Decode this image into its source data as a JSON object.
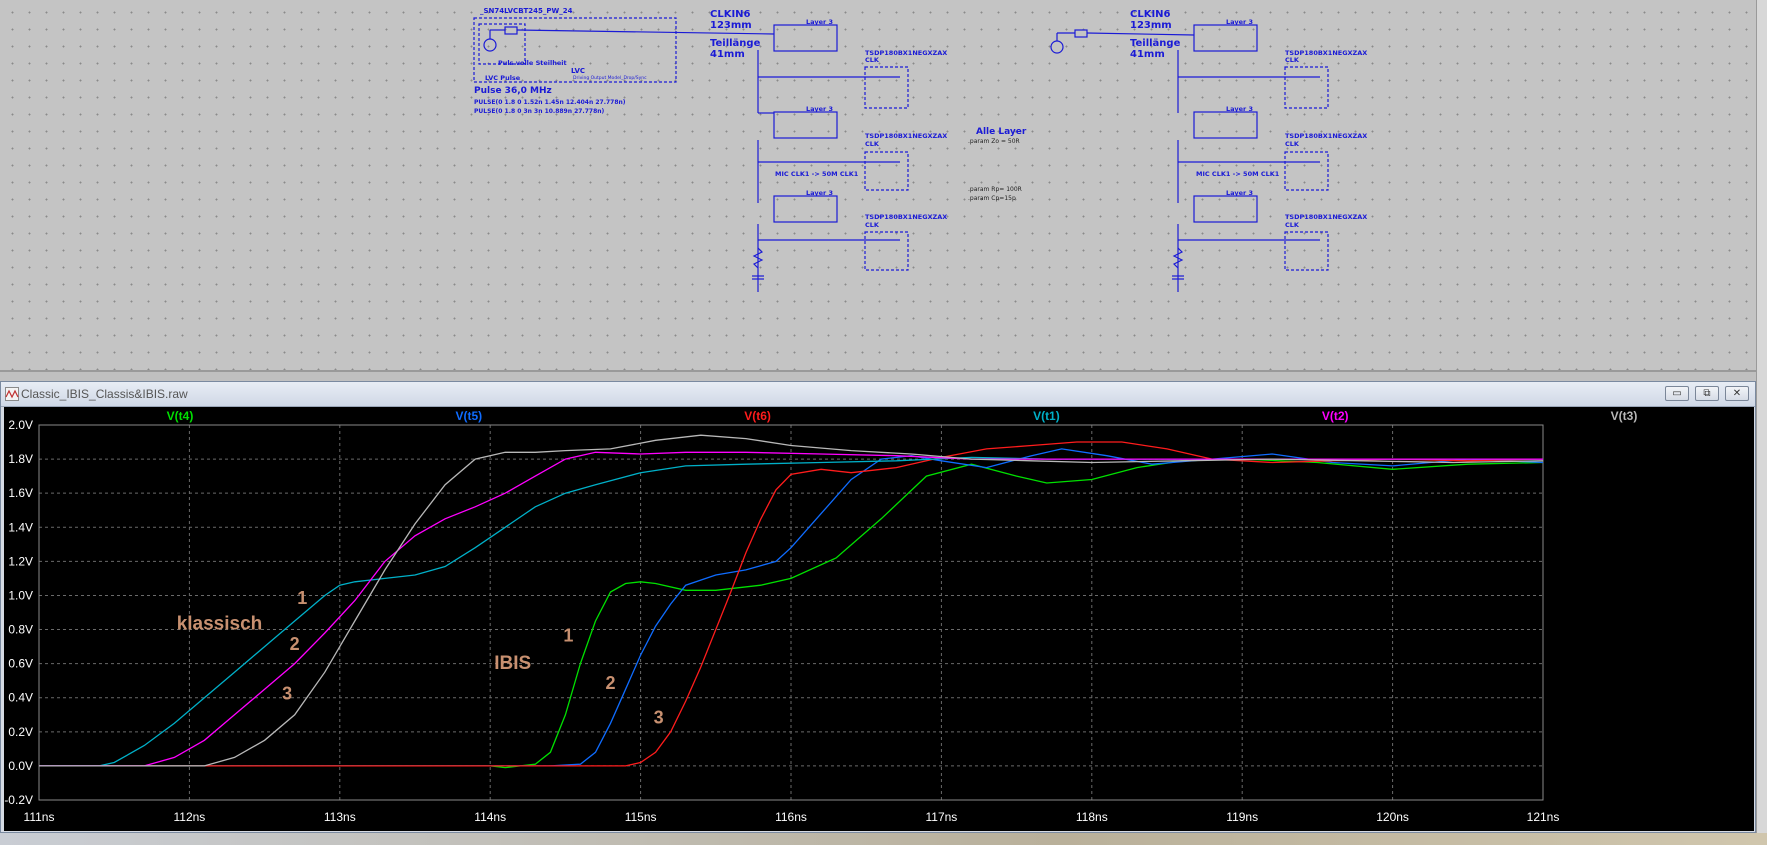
{
  "schematic": {
    "left_circuit": {
      "component_title": "_SN74LVCBT245_PW_24",
      "source_name": "Puls volle Steilheit",
      "block_label": "LVC",
      "block_sublabel": "Driving Output Model_Drop/Sync",
      "pulse_label": "LVC Pulse",
      "pulse_freq": "Pulse 36,0 MHz",
      "pulse_line_1": "PULSE(0 1.8 0 1.52n 1.45n 12.404n 27.778n)",
      "pulse_line_2": "PULSE(0 1.8 0 3n 3n 10.889n 27.778n)",
      "net_label": "CLKIN6",
      "length": "123mm",
      "segment_label": "Teillänge",
      "segment_length": "41mm",
      "layer_labels": [
        "Layer 3",
        "Layer 3",
        "Layer 3"
      ],
      "receiver_labels": [
        "TSDP180BX1NEGXZAX",
        "TSDP180BX1NEGXZAX",
        "TSDP180BX1NEGXZAX"
      ],
      "receiver_pin": "CLK",
      "mid_note": "MIC CLK1 -> 50M CLK1"
    },
    "right_circuit": {
      "net_label": "CLKIN6",
      "length": "123mm",
      "segment_label": "Teillänge",
      "segment_length": "41mm",
      "layer_labels": [
        "Layer 3",
        "Layer 3",
        "Layer 3"
      ],
      "receiver_labels": [
        "TSDP180BX1NEGXZAX",
        "TSDP180BX1NEGXZAX",
        "TSDP180BX1NEGXZAX"
      ],
      "receiver_pin": "CLK",
      "mid_note": "MIC CLK1 -> 50M CLK1"
    },
    "params": {
      "header": "Alle Layer",
      "zo": ".param Zo = 50R",
      "rp": ".param Rp= 100R",
      "cp": ".param Cp=15p"
    }
  },
  "window": {
    "title": "Classic_IBIS_Classis&IBIS.raw",
    "min_glyph": "▭",
    "max_glyph": "⧉",
    "close_glyph": "✕"
  },
  "chart_data": {
    "type": "line",
    "xlabel": "",
    "ylabel": "",
    "xlim": [
      111,
      121
    ],
    "ylim": [
      -0.2,
      2.0
    ],
    "grid": true,
    "x_ticks": [
      "111ns",
      "112ns",
      "113ns",
      "114ns",
      "115ns",
      "116ns",
      "117ns",
      "118ns",
      "119ns",
      "120ns",
      "121ns"
    ],
    "y_ticks": [
      "-0.2V",
      "0.0V",
      "0.2V",
      "0.4V",
      "0.6V",
      "0.8V",
      "1.0V",
      "1.2V",
      "1.4V",
      "1.6V",
      "1.8V",
      "2.0V"
    ],
    "legend_placement": "top",
    "series": [
      {
        "name": "V(t4)",
        "color": "#00e000",
        "x": [
          111,
          113.5,
          114.0,
          114.1,
          114.2,
          114.3,
          114.4,
          114.5,
          114.6,
          114.7,
          114.8,
          114.9,
          115.0,
          115.1,
          115.3,
          115.5,
          115.8,
          116.0,
          116.3,
          116.6,
          116.9,
          117.2,
          117.5,
          117.7,
          118.0,
          118.3,
          118.6,
          119,
          119.5,
          120,
          120.5,
          121
        ],
        "y": [
          0,
          0,
          0,
          -0.01,
          0,
          0.01,
          0.08,
          0.3,
          0.6,
          0.85,
          1.02,
          1.07,
          1.08,
          1.07,
          1.03,
          1.03,
          1.06,
          1.1,
          1.22,
          1.45,
          1.7,
          1.77,
          1.7,
          1.66,
          1.68,
          1.75,
          1.79,
          1.8,
          1.78,
          1.74,
          1.77,
          1.78
        ]
      },
      {
        "name": "V(t5)",
        "color": "#0f6cff",
        "x": [
          111,
          114.4,
          114.6,
          114.7,
          114.8,
          114.9,
          115.0,
          115.1,
          115.2,
          115.3,
          115.5,
          115.7,
          115.9,
          116.0,
          116.2,
          116.4,
          116.6,
          116.8,
          117.0,
          117.3,
          117.6,
          117.8,
          118.1,
          118.4,
          118.8,
          119.2,
          119.6,
          120,
          120.5,
          121
        ],
        "y": [
          0,
          0,
          0.01,
          0.08,
          0.25,
          0.45,
          0.65,
          0.82,
          0.95,
          1.06,
          1.12,
          1.15,
          1.2,
          1.28,
          1.48,
          1.68,
          1.8,
          1.82,
          1.79,
          1.75,
          1.82,
          1.86,
          1.82,
          1.77,
          1.8,
          1.83,
          1.78,
          1.76,
          1.8,
          1.78
        ]
      },
      {
        "name": "V(t6)",
        "color": "#ff1c1c",
        "x": [
          111,
          114.8,
          114.9,
          115.0,
          115.1,
          115.2,
          115.3,
          115.4,
          115.5,
          115.6,
          115.7,
          115.8,
          115.9,
          116.0,
          116.2,
          116.4,
          116.7,
          117.0,
          117.3,
          117.6,
          117.9,
          118.2,
          118.5,
          118.8,
          119.2,
          119.6,
          120,
          120.5,
          121
        ],
        "y": [
          0,
          0,
          0,
          0.02,
          0.08,
          0.2,
          0.38,
          0.58,
          0.8,
          1.02,
          1.25,
          1.45,
          1.62,
          1.71,
          1.74,
          1.72,
          1.75,
          1.81,
          1.86,
          1.88,
          1.9,
          1.9,
          1.86,
          1.8,
          1.78,
          1.79,
          1.8,
          1.79,
          1.8
        ]
      },
      {
        "name": "V(t1)",
        "color": "#00b0c8",
        "x": [
          111,
          111.4,
          111.5,
          111.7,
          111.9,
          112.1,
          112.3,
          112.5,
          112.7,
          112.9,
          113.0,
          113.1,
          113.3,
          113.5,
          113.7,
          113.9,
          114.1,
          114.3,
          114.5,
          114.7,
          115.0,
          115.3,
          115.7,
          116.2,
          116.7,
          117.2,
          117.7,
          118.2,
          118.8,
          119.4,
          120,
          120.5,
          121
        ],
        "y": [
          0,
          0,
          0.02,
          0.12,
          0.25,
          0.4,
          0.55,
          0.7,
          0.85,
          1.0,
          1.06,
          1.08,
          1.1,
          1.12,
          1.17,
          1.28,
          1.4,
          1.52,
          1.6,
          1.65,
          1.72,
          1.76,
          1.77,
          1.78,
          1.79,
          1.81,
          1.8,
          1.8,
          1.8,
          1.8,
          1.8,
          1.8,
          1.8
        ]
      },
      {
        "name": "V(t2)",
        "color": "#ff00ff",
        "x": [
          111,
          111.7,
          111.9,
          112.1,
          112.3,
          112.5,
          112.7,
          112.9,
          113.1,
          113.3,
          113.5,
          113.7,
          113.9,
          114.1,
          114.3,
          114.5,
          114.7,
          115.0,
          115.3,
          115.7,
          116.2,
          116.7,
          117.2,
          117.7,
          118.2,
          118.8,
          119.4,
          120,
          120.5,
          121
        ],
        "y": [
          0,
          0,
          0.05,
          0.15,
          0.3,
          0.45,
          0.6,
          0.78,
          0.97,
          1.2,
          1.35,
          1.45,
          1.52,
          1.6,
          1.7,
          1.8,
          1.84,
          1.83,
          1.84,
          1.84,
          1.83,
          1.82,
          1.8,
          1.8,
          1.8,
          1.8,
          1.8,
          1.8,
          1.8,
          1.8
        ]
      },
      {
        "name": "V(t3)",
        "color": "#b8b8b8",
        "x": [
          111,
          112.1,
          112.3,
          112.5,
          112.7,
          112.9,
          113.1,
          113.3,
          113.5,
          113.7,
          113.9,
          114.1,
          114.3,
          114.5,
          114.8,
          115.1,
          115.4,
          115.7,
          116.0,
          116.4,
          116.8,
          117.2,
          117.6,
          118,
          118.6,
          119.2,
          119.8,
          120.4,
          121
        ],
        "y": [
          0,
          0,
          0.05,
          0.15,
          0.3,
          0.55,
          0.85,
          1.15,
          1.42,
          1.65,
          1.8,
          1.84,
          1.84,
          1.85,
          1.86,
          1.91,
          1.94,
          1.92,
          1.88,
          1.85,
          1.83,
          1.8,
          1.79,
          1.78,
          1.79,
          1.8,
          1.79,
          1.78,
          1.79
        ]
      }
    ],
    "annotations": [
      {
        "text": "klassisch",
        "x": 112.2,
        "y": 0.8
      },
      {
        "text": "1",
        "x": 112.75,
        "y": 0.95
      },
      {
        "text": "2",
        "x": 112.7,
        "y": 0.68
      },
      {
        "text": "3",
        "x": 112.65,
        "y": 0.39
      },
      {
        "text": "IBIS",
        "x": 114.15,
        "y": 0.57
      },
      {
        "text": "1",
        "x": 114.52,
        "y": 0.73
      },
      {
        "text": "2",
        "x": 114.8,
        "y": 0.45
      },
      {
        "text": "3",
        "x": 115.12,
        "y": 0.25
      }
    ],
    "annotation_color": "#c89070"
  }
}
